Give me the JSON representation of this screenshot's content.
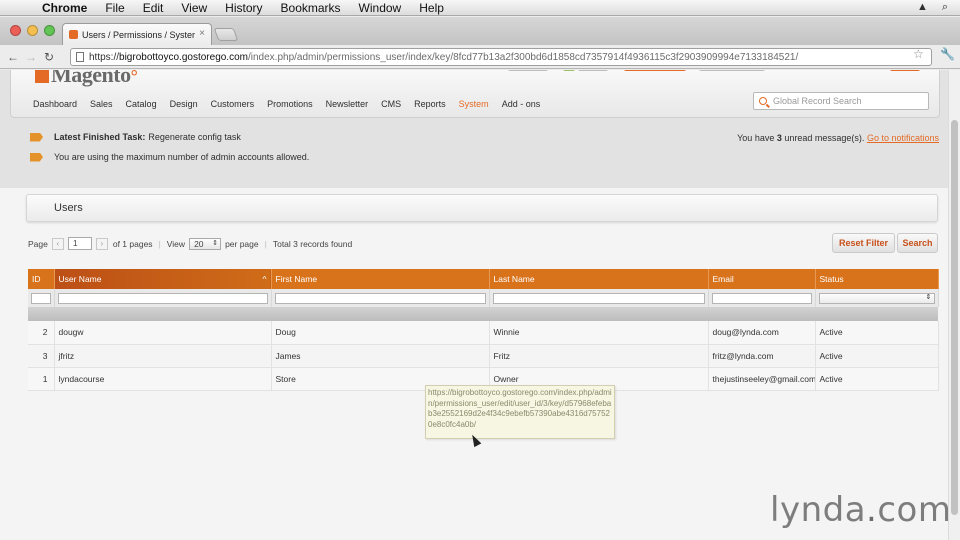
{
  "menubar": {
    "app": "Chrome",
    "items": [
      "File",
      "Edit",
      "View",
      "History",
      "Bookmarks",
      "Window",
      "Help"
    ]
  },
  "browser": {
    "tab_title": "Users / Permissions / Syster",
    "url_domain": "bigrobottoyco.gostorego.com",
    "url_path": "/index.php/admin/permissions_user/index/key/8fcd77b13a2f300bd6d1858cd7357914f4936115c3f2903909994e7133184521/",
    "icons": {
      "back": "back-arrow-icon",
      "forward": "forward-arrow-icon",
      "reload": "reload-icon",
      "bookmark": "star-icon",
      "settings": "wrench-icon"
    }
  },
  "header": {
    "logo_text": "Magento",
    "nav": [
      "Dashboard",
      "Sales",
      "Catalog",
      "Design",
      "Customers",
      "Promotions",
      "Newsletter",
      "CMS",
      "Reports",
      "System",
      "Add - ons"
    ],
    "active_nav": "System",
    "search_placeholder": "Global Record Search"
  },
  "messages": {
    "task_label": "Latest Finished Task:",
    "task_text": "Regenerate config task",
    "limit_text": "You are using the maximum number of admin accounts allowed.",
    "unread_prefix": "You have",
    "unread_count": "3",
    "unread_suffix": "unread message(s).",
    "unread_link": "Go to notifications"
  },
  "section": {
    "title": "Users"
  },
  "pager": {
    "page_label": "Page",
    "page_value": "1",
    "of_pages": "of 1 pages",
    "view_label": "View",
    "per_page_value": "20",
    "per_page_label": "per page",
    "total": "Total 3 records found"
  },
  "buttons": {
    "reset": "Reset Filter",
    "search": "Search"
  },
  "grid": {
    "columns": [
      "ID",
      "User Name",
      "First Name",
      "Last Name",
      "Email",
      "Status"
    ],
    "rows": [
      [
        "2",
        "dougw",
        "Doug",
        "Winnie",
        "doug@lynda.com",
        "Active"
      ],
      [
        "3",
        "jfritz",
        "James",
        "Fritz",
        "fritz@lynda.com",
        "Active"
      ],
      [
        "1",
        "lyndacourse",
        "Store",
        "Owner",
        "thejustinseeley@gmail.com",
        "Active"
      ]
    ]
  },
  "tooltip": {
    "text": "https://bigrobottoyco.gostorego.com/index.php/admin/permissions_user/edit/user_id/3/key/d57968efebab3e2552169d2e4f34c9ebefb57390abe4316d757520e8c0fc4a0b/"
  },
  "watermark": {
    "brand": "lynda",
    "dot": ".",
    "tld": "com"
  },
  "colors": {
    "accent": "#e46b26",
    "grid_header": "#d8731c"
  }
}
